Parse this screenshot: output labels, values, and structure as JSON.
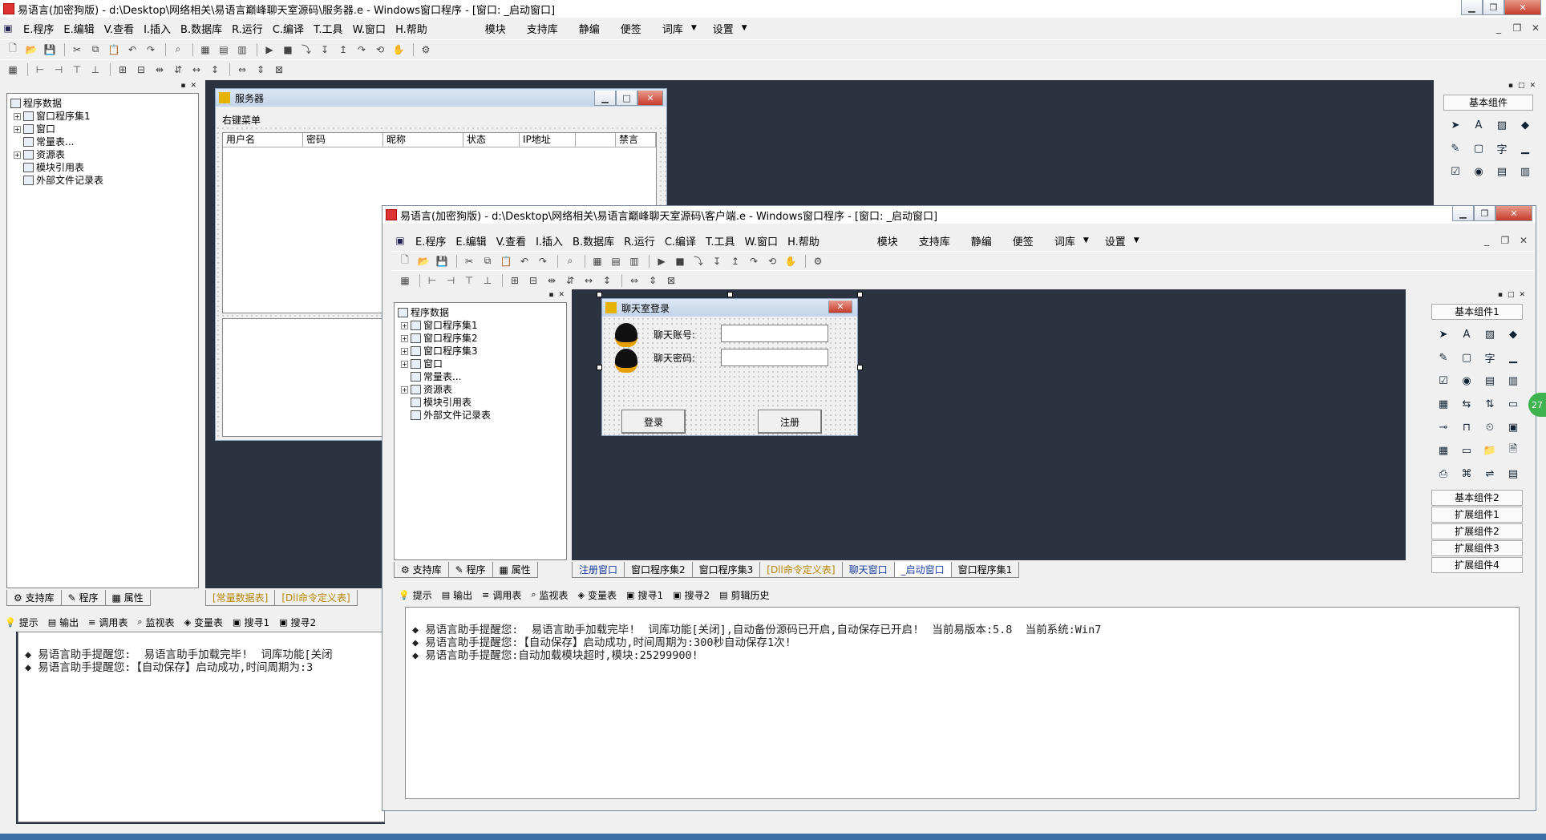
{
  "main_window": {
    "title": "易语言(加密狗版) - d:\\Desktop\\网络相关\\易语言巅峰聊天室源码\\服务器.e - Windows窗口程序 - [窗口: _启动窗口]",
    "menu": [
      "E.程序",
      "E.编辑",
      "V.查看",
      "I.插入",
      "B.数据库",
      "R.运行",
      "C.编译",
      "T.工具",
      "W.窗口",
      "H.帮助"
    ],
    "menu_extra": [
      "模块",
      "支持库",
      "静编",
      "便签",
      "词库",
      "设置"
    ],
    "tree": {
      "root": "程序数据",
      "items": [
        "窗口程序集1",
        "窗口",
        "常量表...",
        "资源表",
        "模块引用表",
        "外部文件记录表"
      ]
    },
    "left_tabs": [
      "支持库",
      "程序",
      "属性"
    ],
    "editor_tabs": [
      "[常量数据表]",
      "[Dll命令定义表]"
    ],
    "bottom_tabs": [
      "提示",
      "输出",
      "调用表",
      "监视表",
      "变量表",
      "搜寻1",
      "搜寻2"
    ],
    "output_lines": [
      "◆ 易语言助手提醒您:  易语言助手加载完毕!  词库功能[关闭",
      "",
      "◆ 易语言助手提醒您:【自动保存】启动成功,时间周期为:3"
    ]
  },
  "server_form": {
    "title": "服务器",
    "menu_label": "右键菜单",
    "columns": [
      "用户名",
      "密码",
      "昵称",
      "状态",
      "IP地址",
      "",
      "禁言"
    ]
  },
  "client_window": {
    "title": "易语言(加密狗版) - d:\\Desktop\\网络相关\\易语言巅峰聊天室源码\\客户端.e - Windows窗口程序 - [窗口: _启动窗口]",
    "menu": [
      "E.程序",
      "E.编辑",
      "V.查看",
      "I.插入",
      "B.数据库",
      "R.运行",
      "C.编译",
      "T.工具",
      "W.窗口",
      "H.帮助"
    ],
    "menu_extra": [
      "模块",
      "支持库",
      "静编",
      "便签",
      "词库",
      "设置"
    ],
    "tree": {
      "root": "程序数据",
      "items": [
        "窗口程序集1",
        "窗口程序集2",
        "窗口程序集3",
        "窗口",
        "常量表...",
        "资源表",
        "模块引用表",
        "外部文件记录表"
      ]
    },
    "left_tabs": [
      "支持库",
      "程序",
      "属性"
    ],
    "editor_tabs": [
      "注册窗口",
      "窗口程序集2",
      "窗口程序集3",
      "[Dll命令定义表]",
      "聊天窗口",
      "_启动窗口",
      "窗口程序集1"
    ],
    "bottom_tabs": [
      "提示",
      "输出",
      "调用表",
      "监视表",
      "变量表",
      "搜寻1",
      "搜寻2",
      "剪辑历史"
    ],
    "output_lines": [
      "◆ 易语言助手提醒您:  易语言助手加载完毕!  词库功能[关闭],自动备份源码已开启,自动保存已开启!  当前易版本:5.8  当前系统:Win7",
      "",
      "◆ 易语言助手提醒您:【自动保存】启动成功,时间周期为:300秒自动保存1次!",
      "◆ 易语言助手提醒您:自动加载模块超时,模块:25299900!"
    ],
    "palette_header": "基本组件1",
    "palette_categories": [
      "基本组件2",
      "扩展组件1",
      "扩展组件2",
      "扩展组件3",
      "扩展组件4"
    ]
  },
  "main_palette_header": "基本组件",
  "login_form": {
    "title": "聊天室登录",
    "account_label": "聊天账号:",
    "password_label": "聊天密码:",
    "login_button": "登录",
    "register_button": "注册"
  },
  "side_badge": "27"
}
